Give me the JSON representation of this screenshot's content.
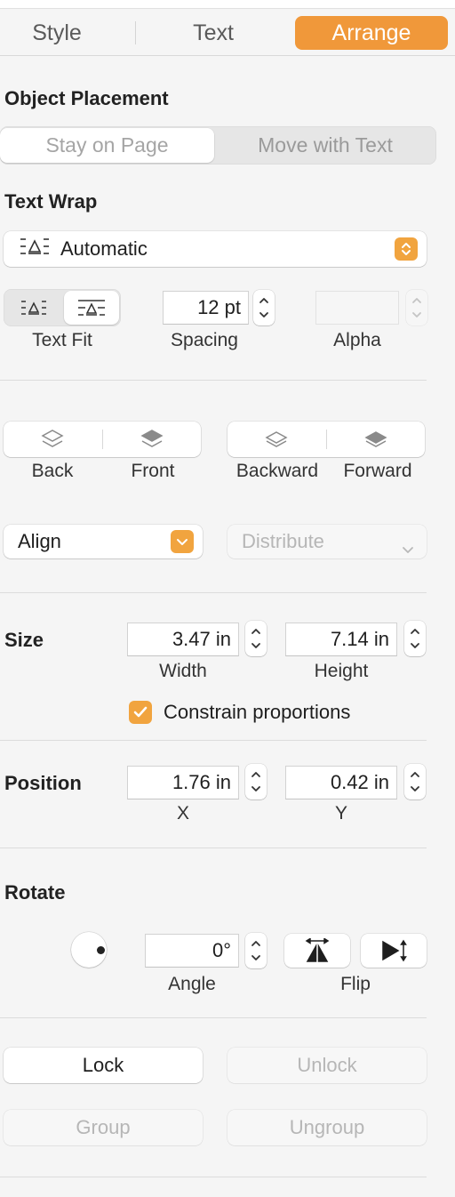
{
  "tabs": [
    {
      "label": "Style"
    },
    {
      "label": "Text"
    },
    {
      "label": "Arrange"
    }
  ],
  "object_placement": {
    "title": "Object Placement",
    "options": [
      "Stay on Page",
      "Move with Text"
    ],
    "selected": "Stay on Page"
  },
  "text_wrap": {
    "title": "Text Wrap",
    "value": "Automatic",
    "text_fit_label": "Text Fit",
    "spacing_value": "12 pt",
    "spacing_label": "Spacing",
    "alpha_value": "",
    "alpha_label": "Alpha"
  },
  "arrange": {
    "back_label": "Back",
    "front_label": "Front",
    "backward_label": "Backward",
    "forward_label": "Forward",
    "align_label": "Align",
    "distribute_label": "Distribute"
  },
  "size": {
    "title": "Size",
    "width_value": "3.47 in",
    "width_label": "Width",
    "height_value": "7.14 in",
    "height_label": "Height",
    "constrain_label": "Constrain proportions",
    "constrain_checked": true
  },
  "position": {
    "title": "Position",
    "x_value": "1.76 in",
    "x_label": "X",
    "y_value": "0.42 in",
    "y_label": "Y"
  },
  "rotate": {
    "title": "Rotate",
    "angle_value": "0°",
    "angle_label": "Angle",
    "flip_label": "Flip"
  },
  "lock": {
    "lock_label": "Lock",
    "unlock_label": "Unlock",
    "group_label": "Group",
    "ungroup_label": "Ungroup"
  },
  "colors": {
    "accent": "#f0983a",
    "panel_bg": "#f5f5f5"
  }
}
